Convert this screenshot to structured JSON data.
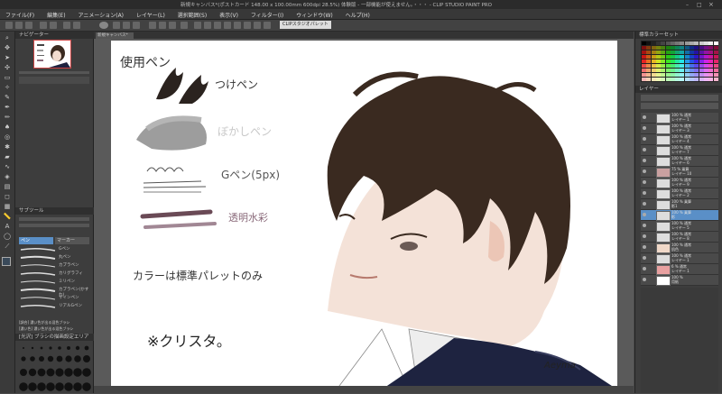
{
  "window": {
    "title": "新規キャンバス*(ポストカード 148.00 x 100.00mm 600dpi 28.5%) 体験版 - 一部機能が使えません。・・・ - CLIP STUDIO PAINT PRO"
  },
  "menu": [
    "ファイル(F)",
    "編集(E)",
    "アニメーション(A)",
    "レイヤー(L)",
    "選択範囲(S)",
    "表示(V)",
    "フィルター(I)",
    "ウィンドウ(W)",
    "ヘルプ(H)"
  ],
  "toolbar": {
    "label": "CLIPスタジオパレット"
  },
  "document_tab": "新規キャンバス*",
  "left_panel": {
    "tool_tabs": [
      "ペン",
      "マーカー"
    ],
    "brush_list": [
      "Gペン",
      "丸ペン",
      "カブラペン",
      "カリグラフィ",
      "ミリペン",
      "カブラペン(かすれ)",
      "サインペン",
      "リアルGペン"
    ],
    "brush_note_1": "[調合] 濃い色が出る混色ブラシ",
    "brush_note_2": "[濃い色] 濃い色が出る混色ブラシ",
    "bottom_label": "[光沢] ブラシの描画設定エリア"
  },
  "canvas": {
    "title_label": "使用ペン",
    "pen1": "つけペン",
    "pen2": "ぼかしペン",
    "pen3": "Gペン(5px)",
    "pen4": "透明水彩",
    "note": "カラーは標準パレットのみ",
    "app_note": "※クリスタ。",
    "signature": "Aeyma"
  },
  "right_panel": {
    "palette_title": "標準カラーセット",
    "layers": [
      {
        "name": "100 % 通常",
        "sub": "レイヤー 1"
      },
      {
        "name": "100 % 通常",
        "sub": "レイヤー 3"
      },
      {
        "name": "100 % 通常",
        "sub": "レイヤー 4"
      },
      {
        "name": "100 % 通常",
        "sub": "レイヤー 7"
      },
      {
        "name": "100 % 通常",
        "sub": "レイヤー 6"
      },
      {
        "name": "75 % 乗算",
        "sub": "レイヤー 10"
      },
      {
        "name": "100 % 通常",
        "sub": "レイヤー 9"
      },
      {
        "name": "100 % 通常",
        "sub": "レイヤー 2"
      },
      {
        "name": "100 % 乗算",
        "sub": "影1"
      },
      {
        "name": "100 % 乗算",
        "sub": "影"
      },
      {
        "name": "100 % 通常",
        "sub": "レイヤー 5"
      },
      {
        "name": "100 % 通常",
        "sub": "レイヤー 8"
      },
      {
        "name": "100 % 通常",
        "sub": "肌色"
      },
      {
        "name": "100 % 通常",
        "sub": "レイヤー 1"
      },
      {
        "name": "6 % 通常",
        "sub": "レイヤー 1"
      },
      {
        "name": "100 %",
        "sub": "用紙"
      }
    ]
  },
  "colors": {
    "bg": "#4a4a4a",
    "paper": "#ffffff",
    "accent": "#5a8fc7",
    "hair": "#3a2a20",
    "mauve": "#8a6a7a"
  }
}
